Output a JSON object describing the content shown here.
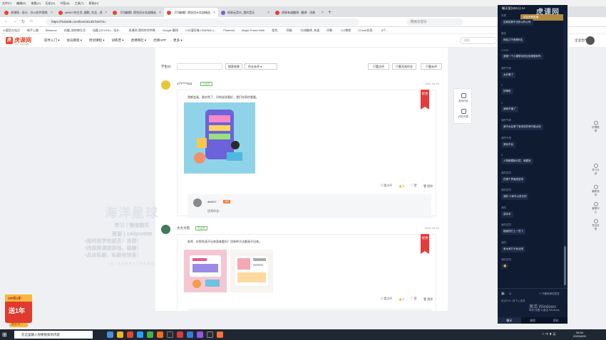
{
  "menubar": [
    "文件(F)",
    "编辑(E)",
    "查看(V)",
    "历史(S)",
    "书签(B)",
    "工具(T)",
    "帮助(H)"
  ],
  "tabs": [
    {
      "label": "虎课网 - 设计、办公软件视频",
      "color": "#e4462c"
    },
    {
      "label": "alki007的主页_摄影_作品 - 虎",
      "color": "#e4462c"
    },
    {
      "label": "【可编辑】视觉设计实战精选",
      "color": "#e4462c"
    },
    {
      "label": "【可编辑】视觉设计实战精选",
      "color": "#e4462c"
    },
    {
      "label": "网易云音乐_我的音乐",
      "color": "#7b5cd6"
    },
    {
      "label": "网易有道翻译 · 翻译 · 词典",
      "color": "#e23b3b"
    }
  ],
  "newtab_label": "+",
  "address": {
    "url": "https://huke88.com/live/33138.html?a=",
    "search_placeholder": "网易云音乐"
  },
  "bookmarks": [
    "火狐官方站点",
    "新手上路",
    "Behance",
    "花瓣_陪你做生活",
    "站酷 (ZCOOL) - 设计...",
    "虎课网-我的你学特殊",
    "Google 翻译",
    "C4D爱好者-CINEMA 4...",
    "Pinterest",
    "Magic Power Web",
    "配色..",
    "四维..",
    "在线翻译_有道",
    "印象..",
    "CG教程",
    "CCash实用..",
    "5个..."
  ],
  "site": {
    "logo_mark": "虎",
    "logo_name": "虎课网",
    "logo_sub": "学设计就来虎课网",
    "nav": [
      "软件入门 ▾",
      "会员教程 ▾",
      "原创课程 ▾",
      "训练营 ▾",
      "虎课网社 ▾",
      "虎课APP",
      "更多 ▾"
    ],
    "search_placeholder": "搜索",
    "right_text": "企业合作"
  },
  "toolbar": {
    "student_id_label": "学生ID",
    "search_button": "搜索结果",
    "status_select": "作业未评 ▾",
    "btn_reviewed": "只看点评",
    "btn_unreviewed": "只看无效作业",
    "btn_pending": "只看未评"
  },
  "posts": [
    {
      "user": "177****511",
      "badge": "已点评",
      "date": "2022-04-20",
      "text": "我都会画，跟实例了，问他说说看好，我们先帮你看看。",
      "ribbon": "优秀",
      "actions": {
        "comment": "看点评",
        "likes": "0",
        "like_label": "赞",
        "delete": "删除"
      },
      "reply": {
        "user": "alki007",
        "tag": "讲师",
        "text": "优秀作业~"
      }
    },
    {
      "user": "大大大塔",
      "badge": "已点评",
      "date": "2022-04-20",
      "text": "老师，好那些画不出来蛮难看吗？用各种方法都画不出来。",
      "ribbon": "优秀",
      "actions": {
        "comment": "看点评",
        "likes": "0",
        "like_label": "赞",
        "delete": "删除"
      },
      "reply": {
        "user": "alki007",
        "tag": "讲师",
        "text": ""
      }
    }
  ],
  "float_tools": [
    "发布作业",
    "作业列表"
  ],
  "right_rail": [
    "好课推荐",
    "学习计划",
    "最新资讯",
    "客服中心",
    "意见反馈"
  ],
  "watermark": {
    "big": "海洋星球",
    "line1": "学习丨微信购买",
    "line2": "资源丨c4dpro998",
    "bullets": [
      "•报的班学完就丢！浪费！",
      "•找我换课或换钱，稳赚！",
      "•具体私聊，私聊有惊喜！"
    ],
    "small": "• 加 入 会 员 免 费 学 习 所 有 课 程 •"
  },
  "vip": {
    "top": "VIP买1年",
    "main": "送1年",
    "sub": "直送1年"
  },
  "chat": {
    "title": "聊天室(132人)  A+",
    "gold_banner": "欢迎来看直播~",
    "messages": [
      {
        "name": "冬寒",
        "text": "这期讲解不出所以所以吗"
      },
      {
        "name": "落花",
        "text": "网站几千都是B站"
      },
      {
        "name": "YOHO",
        "text": "我做一个小模型动效比较难做到吗"
      },
      {
        "name": "我的气球",
        "text": "太好看了"
      },
      {
        "name": "V",
        "text": "好精彩"
      },
      {
        "name": "V",
        "text": "我就不懂了"
      },
      {
        "name": "我的气球",
        "text": "我不太会等了老师讲的有时候太快"
      },
      {
        "name": "我的气球",
        "text": "我玩不会"
      },
      {
        "name": "V",
        "text": "人物都模板分层，我要用"
      },
      {
        "name": "我的成员",
        "text": "在哪个界面找进来"
      },
      {
        "name": "我的成员",
        "text": "我的 人家可以多长的"
      },
      {
        "name": "我的",
        "text": "成本本"
      },
      {
        "name": "我的成员",
        "text": "超级快打上一些飞"
      },
      {
        "name": "我的",
        "text": "有木有打卡有点呢"
      },
      {
        "name": "我的成员",
        "text": "😊"
      }
    ],
    "input_placeholder": "说点什么~按下上发送",
    "only_teacher": "只看老师的发言",
    "tabs": [
      "聊天",
      "课程",
      "资料"
    ],
    "brand_watermark": "虎课网"
  },
  "windows_activation": {
    "title": "激活 Windows",
    "sub": "转到\"设置\"以激活 Windows。"
  },
  "taskbar": {
    "search_placeholder": "在这里输入你要搜索的内容",
    "time": "20:04",
    "date": "2022/4/20",
    "tray": "∧ 中 ⬆ 英"
  }
}
